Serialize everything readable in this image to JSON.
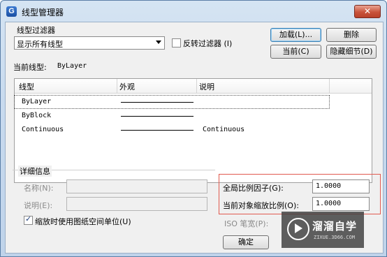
{
  "window": {
    "title": "线型管理器",
    "close_glyph": "✕"
  },
  "filter": {
    "group_label": "线型过滤器",
    "selected": "显示所有线型",
    "invert_label": "反转过滤器 (I)",
    "invert_checked": false
  },
  "buttons": {
    "load": "加载(L)...",
    "delete": "删除",
    "current": "当前(C)",
    "hide_details": "隐藏细节(D)",
    "ok": "确定"
  },
  "current_linetype": {
    "label": "当前线型:",
    "value": "ByLayer"
  },
  "table": {
    "columns": [
      "线型",
      "外观",
      "说明"
    ],
    "rows": [
      {
        "name": "ByLayer",
        "description": ""
      },
      {
        "name": "ByBlock",
        "description": ""
      },
      {
        "name": "Continuous",
        "description": "Continuous"
      }
    ]
  },
  "details": {
    "group_label": "详细信息",
    "name_label": "名称(N):",
    "desc_label": "说明(E):",
    "paper_units_label": "缩放时使用图纸空间单位(U)",
    "paper_units_checked": true,
    "global_scale_label": "全局比例因子(G):",
    "global_scale_value": "1.0000",
    "current_scale_label": "当前对象缩放比例(O):",
    "current_scale_value": "1.0000",
    "iso_pen_label": "ISO 笔宽(P):"
  },
  "watermark": {
    "title": "溜溜自学",
    "url": "ZIXUE.3D66.COM"
  }
}
